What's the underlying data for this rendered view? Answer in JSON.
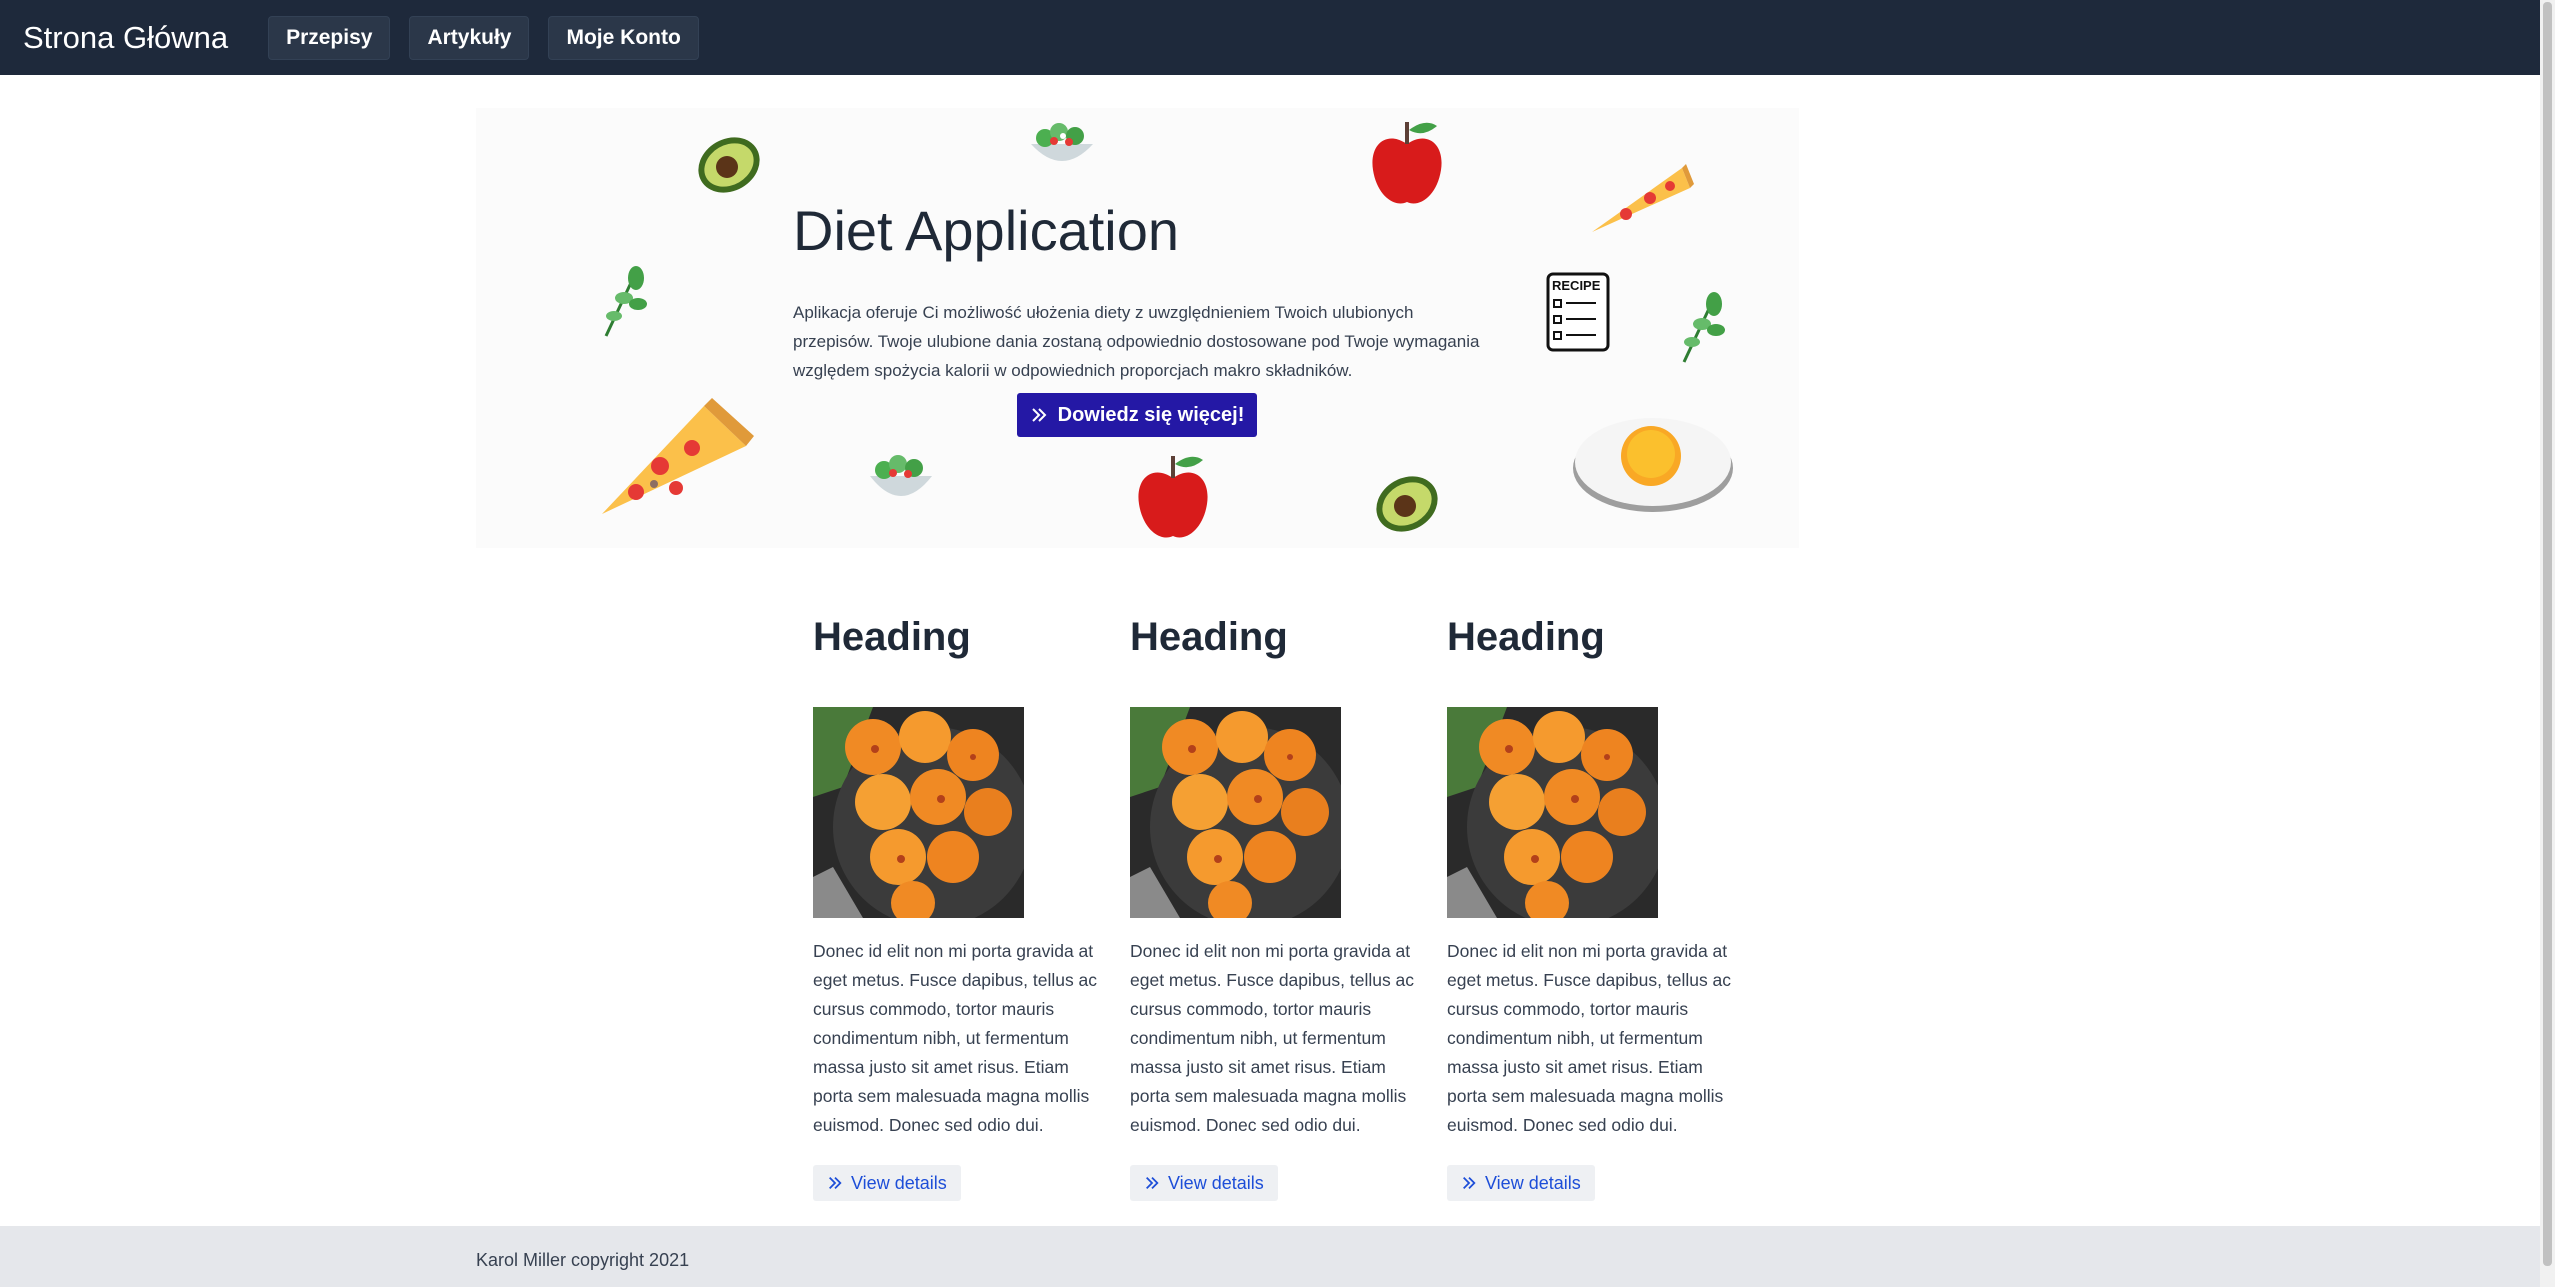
{
  "nav": {
    "brand": "Strona Główna",
    "items": [
      {
        "label": "Przepisy"
      },
      {
        "label": "Artykuły"
      },
      {
        "label": "Moje Konto"
      }
    ]
  },
  "hero": {
    "title": "Diet Application",
    "text": "Aplikacja oferuje Ci możliwość ułożenia diety z uwzględnieniem Twoich ulubionych przepisów. Twoje ulubione dania zostaną odpowiednio dostosowane pod Twoje wymagania względem spożycia kalorii w odpowiednich proporcjach makro składników.",
    "button_label": "Dowiedz się więcej!",
    "recipe_label": "RECIPE"
  },
  "cards": [
    {
      "heading": "Heading",
      "text": "Donec id elit non mi porta gravida at eget metus. Fusce dapibus, tellus ac cursus commodo, tortor mauris condimentum nibh, ut fermentum massa justo sit amet risus. Etiam porta sem malesuada magna mollis euismod. Donec sed odio dui.",
      "button_label": "View details"
    },
    {
      "heading": "Heading",
      "text": "Donec id elit non mi porta gravida at eget metus. Fusce dapibus, tellus ac cursus commodo, tortor mauris condimentum nibh, ut fermentum massa justo sit amet risus. Etiam porta sem malesuada magna mollis euismod. Donec sed odio dui.",
      "button_label": "View details"
    },
    {
      "heading": "Heading",
      "text": "Donec id elit non mi porta gravida at eget metus. Fusce dapibus, tellus ac cursus commodo, tortor mauris condimentum nibh, ut fermentum massa justo sit amet risus. Etiam porta sem malesuada magna mollis euismod. Donec sed odio dui.",
      "button_label": "View details"
    }
  ],
  "footer": {
    "text": "Karol Miller copyright 2021"
  },
  "colors": {
    "navbar": "#1e293b",
    "hero_button": "#2418a5",
    "link": "#1d4ed8",
    "footer": "#e5e7eb"
  },
  "icons": [
    "double-chevron-right-icon",
    "avocado-icon",
    "salad-icon",
    "apple-icon",
    "pizza-icon",
    "herb-icon",
    "recipe-icon",
    "fried-egg-icon"
  ]
}
